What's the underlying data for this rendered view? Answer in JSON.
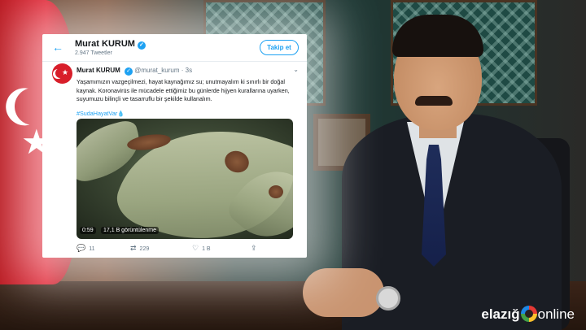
{
  "header": {
    "name": "Murat KURUM",
    "tweet_count": "2.947 Tweetler",
    "follow_label": "Takip et"
  },
  "tweet": {
    "name": "Murat KURUM",
    "handle": "@murat_kurum",
    "time": "3s",
    "text": "Yaşamımızın vazgeçilmezi, hayat kaynağımız su; unutmayalım ki sınırlı bir doğal kaynak. Koronavirüs ile mücadele ettiğimiz bu günlerde hijyen kurallarına uyarken, suyumuzu bilinçli ve tasarruflu bir şekilde kullanalım.",
    "hashtag": "#SudaHayatVar"
  },
  "video": {
    "duration": "0:59",
    "views": "17,1 B görüntülenme"
  },
  "actions": {
    "replies": "11",
    "retweets": "229",
    "likes": "1 B"
  },
  "logo": {
    "part1": "elazığ",
    "part2": "online"
  },
  "colors": {
    "accent": "#1da1f2",
    "flag": "#e02030"
  }
}
